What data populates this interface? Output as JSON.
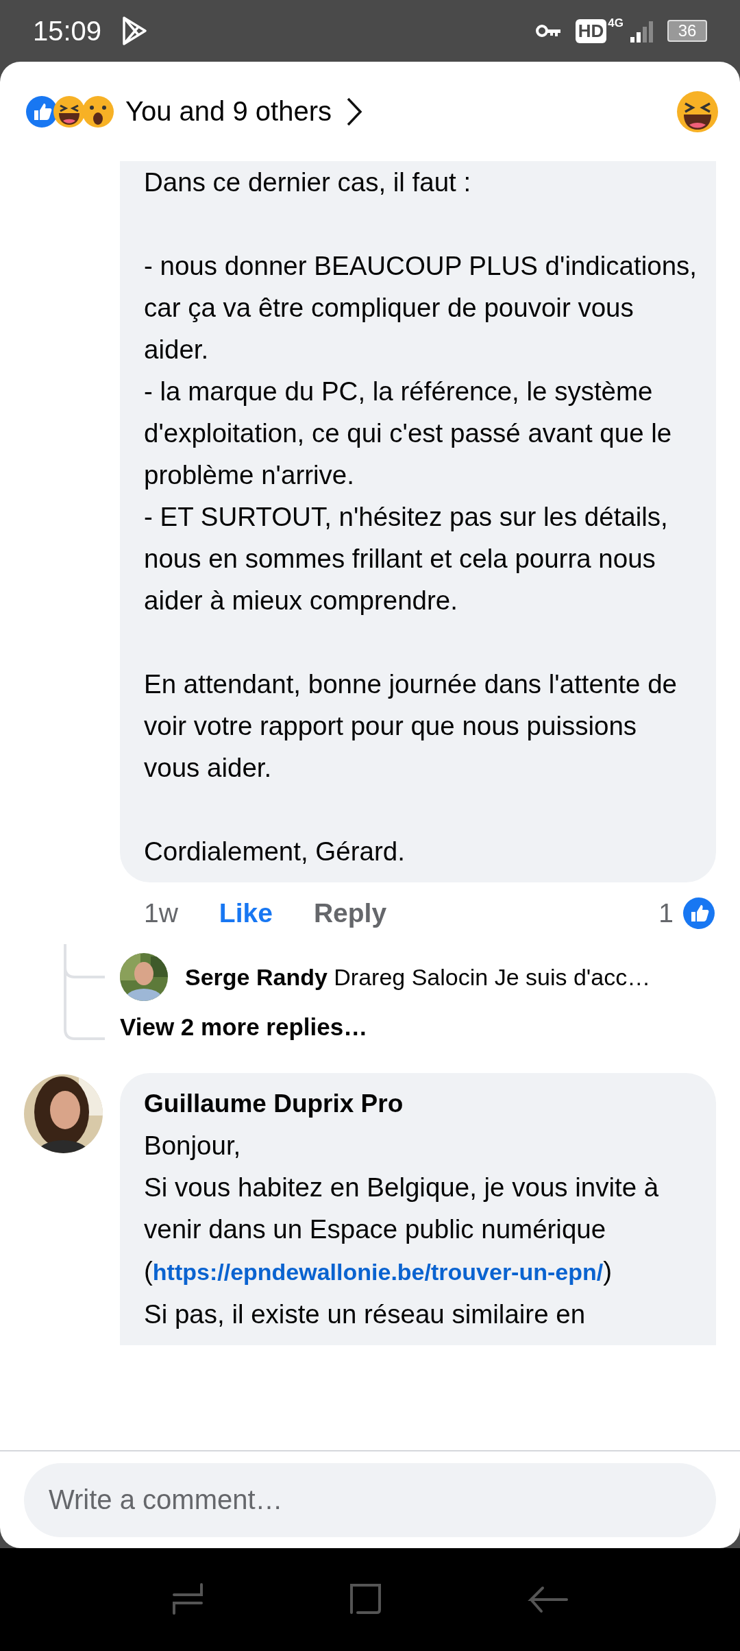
{
  "status_bar": {
    "time": "15:09",
    "hd": "HD",
    "network": "4G",
    "battery": "36"
  },
  "reactions": {
    "summary": "You and 9 others"
  },
  "comments": [
    {
      "kind": "partial",
      "groups": [
        [
          "Dans ce dernier cas, il faut :"
        ],
        [
          "- nous donner BEAUCOUP PLUS d'indications, car ça va être compliquer de pouvoir vous aider.",
          "- la marque du PC, la référence, le système d'exploitation, ce qui c'est passé avant que le problème n'arrive.",
          "- ET SURTOUT, n'hésitez pas sur les détails, nous en sommes frillant et cela pourra nous aider à mieux comprendre."
        ],
        [
          "En attendant, bonne journée dans l'attente de voir votre rapport pour que nous puissions vous aider."
        ],
        [
          "Cordialement, Gérard."
        ]
      ],
      "time": "1w",
      "like": "Like",
      "liked": true,
      "reply": "Reply",
      "like_count": "1",
      "replies": [
        {
          "author": "Serge Randy",
          "text": "Drareg Salocin Je suis d'acc…"
        }
      ],
      "more_replies": "View 2 more replies…"
    },
    {
      "kind": "full",
      "author": "Guillaume Duprix Pro",
      "lines": [
        [
          {
            "text": "Bonjour,"
          }
        ],
        [
          {
            "text": "Si vous habitez en Belgique, je vous invite à venir dans un Espace public numérique ("
          },
          {
            "link": "https://epndewallonie.be/trouver-un-epn/"
          },
          {
            "text": ")"
          }
        ],
        [
          {
            "text": "Si pas, il existe un réseau similaire en"
          }
        ]
      ]
    }
  ],
  "composer": {
    "placeholder": "Write a comment…"
  }
}
